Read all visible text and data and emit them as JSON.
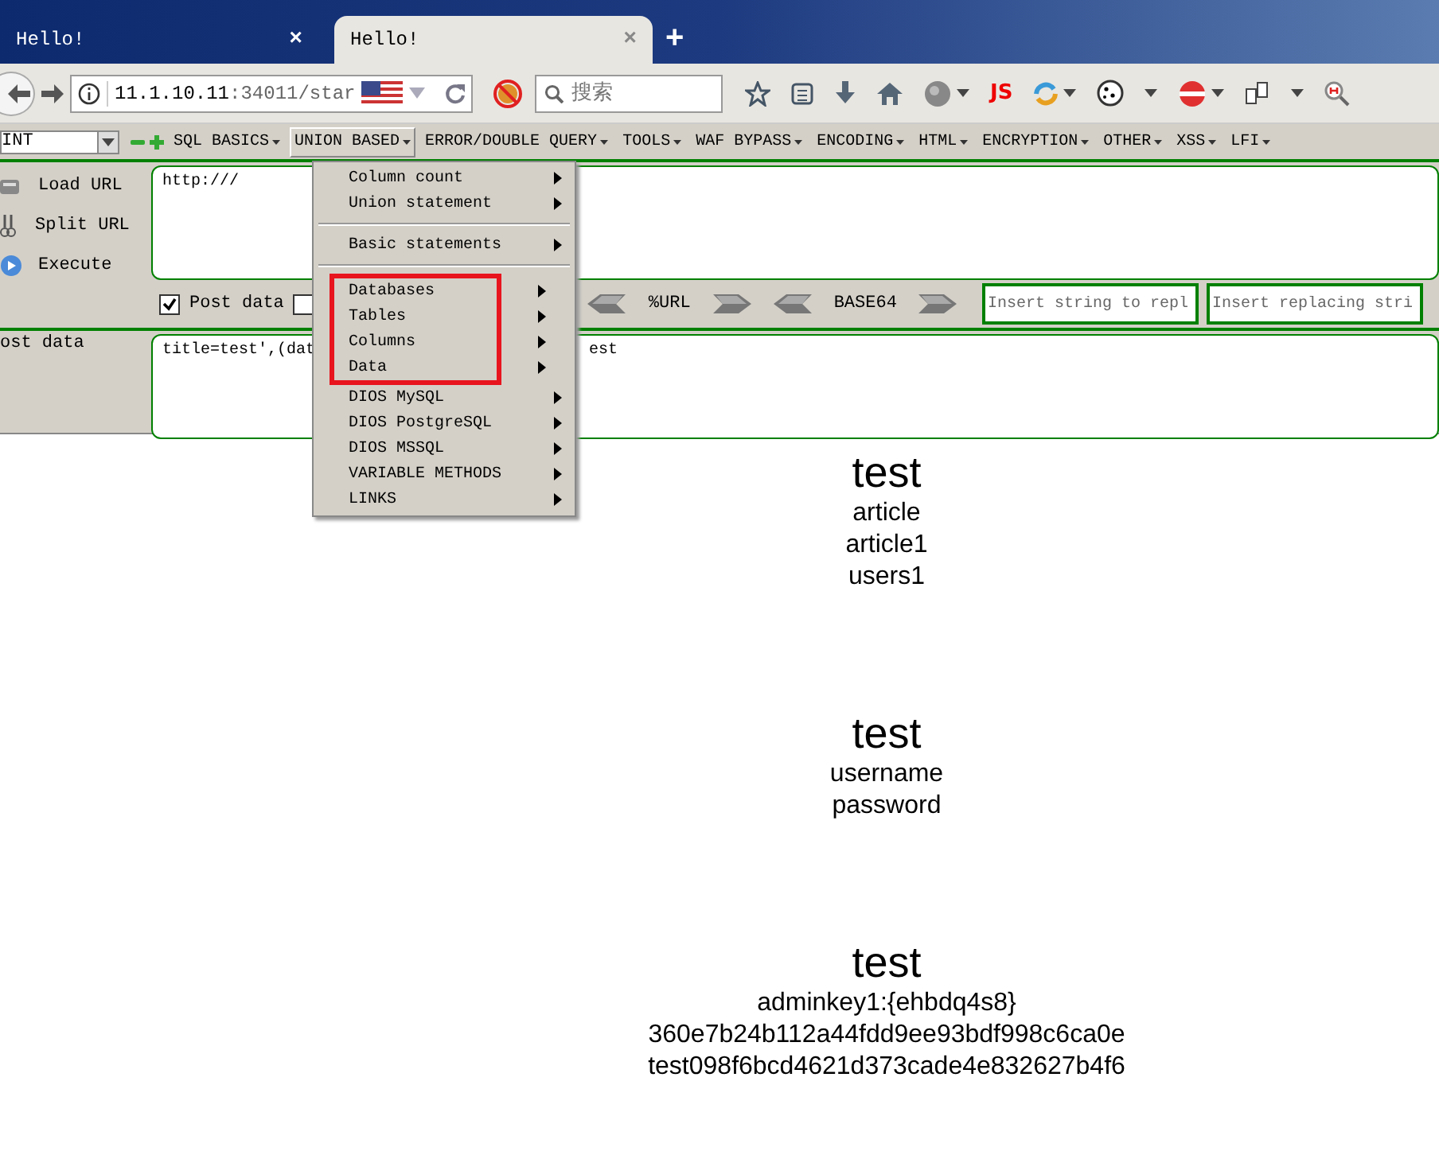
{
  "tabs": [
    {
      "title": "Hello!",
      "close": "×",
      "selected": false
    },
    {
      "title": "Hello!",
      "close": "×",
      "selected": true
    }
  ],
  "new_tab": "+",
  "address": {
    "host": "11.1.10.11",
    "path": ":34011/star"
  },
  "search": {
    "placeholder": "搜索"
  },
  "js_button": "JS",
  "hackbar": {
    "select": "INT",
    "menus": [
      {
        "label": "SQL BASICS",
        "selected": false
      },
      {
        "label": "UNION BASED",
        "selected": true
      },
      {
        "label": "ERROR/DOUBLE QUERY",
        "selected": false
      },
      {
        "label": "TOOLS",
        "selected": false
      },
      {
        "label": "WAF BYPASS",
        "selected": false
      },
      {
        "label": "ENCODING",
        "selected": false
      },
      {
        "label": "HTML",
        "selected": false
      },
      {
        "label": "ENCRYPTION",
        "selected": false
      },
      {
        "label": "OTHER",
        "selected": false
      },
      {
        "label": "XSS",
        "selected": false
      },
      {
        "label": "LFI",
        "selected": false
      }
    ],
    "actions": [
      {
        "kind": "load",
        "label": "Load URL"
      },
      {
        "kind": "split",
        "label": "Split URL"
      },
      {
        "kind": "execute",
        "label": "Execute"
      }
    ],
    "url": "http:///",
    "checkboxes": [
      {
        "label": "Post data",
        "checked": true
      },
      {
        "checked": false
      }
    ],
    "encoders": [
      "%URL",
      "BASE64"
    ],
    "replace_fields": [
      {
        "placeholder": "Insert string to repl"
      },
      {
        "placeholder": "Insert replacing stri"
      }
    ],
    "post_label": "ost data",
    "post_value": "title=test',(dat",
    "post_value_tail": "est"
  },
  "menu": [
    {
      "kind": "item",
      "label": "Column count",
      "boxed": false
    },
    {
      "kind": "item",
      "label": "Union statement",
      "boxed": false
    },
    {
      "kind": "separator"
    },
    {
      "kind": "item",
      "label": "Basic statements",
      "boxed": false
    },
    {
      "kind": "separator"
    },
    {
      "kind": "item",
      "label": "Databases",
      "boxed": true
    },
    {
      "kind": "item",
      "label": "Tables",
      "boxed": true
    },
    {
      "kind": "item",
      "label": "Columns",
      "boxed": true
    },
    {
      "kind": "item",
      "label": "Data",
      "boxed": true
    },
    {
      "kind": "item",
      "label": "DIOS MySQL",
      "boxed": false
    },
    {
      "kind": "item",
      "label": "DIOS PostgreSQL",
      "boxed": false
    },
    {
      "kind": "item",
      "label": "DIOS MSSQL",
      "boxed": false
    },
    {
      "kind": "item",
      "label": "VARIABLE METHODS",
      "boxed": false
    },
    {
      "kind": "item",
      "label": "LINKS",
      "boxed": false
    }
  ],
  "results": [
    {
      "title": "test",
      "lines": [
        "article",
        "article1",
        "users1"
      ]
    },
    {
      "title": "test",
      "lines": [
        "username",
        "password"
      ]
    },
    {
      "title": "test",
      "lines": [
        "adminkey1:{ehbdq4s8}",
        "360e7b24b112a44fdd9ee93bdf998c6ca0e",
        "test098f6bcd4621d373cade4e832627b4f6"
      ]
    }
  ]
}
